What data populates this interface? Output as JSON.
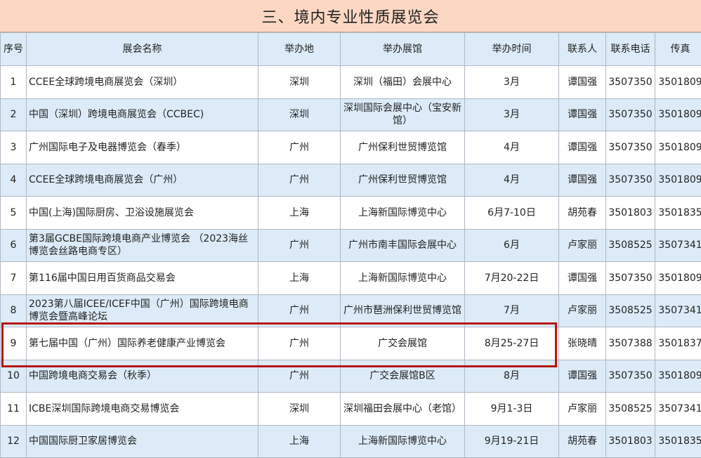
{
  "title": "三、境内专业性质展览会",
  "headers": [
    "序号",
    "展会名称",
    "举办地",
    "举办展馆",
    "举办时间",
    "联系人",
    "联系电话",
    "传真"
  ],
  "rows": [
    {
      "no": "1",
      "name": "CCEE全球跨境电商展览会（深圳）",
      "city": "深圳",
      "venue": "深圳（福田）会展中心",
      "time": "3月",
      "contact": "谭国强",
      "phone": "3507350",
      "fax": "3501809"
    },
    {
      "no": "2",
      "name": "中国（深圳）跨境电商展览会（CCBEC)",
      "city": "深圳",
      "venue": "深圳国际会展中心（宝安新馆）",
      "time": "3月",
      "contact": "谭国强",
      "phone": "3507350",
      "fax": "3501809"
    },
    {
      "no": "3",
      "name": "广州国际电子及电器博览会（春季）",
      "city": "广州",
      "venue": "广州保利世贸博览馆",
      "time": "4月",
      "contact": "谭国强",
      "phone": "3507350",
      "fax": "3501809"
    },
    {
      "no": "4",
      "name": "CCEE全球跨境电商展览会（广州）",
      "city": "广州",
      "venue": "广州保利世贸博览馆",
      "time": "4月",
      "contact": "谭国强",
      "phone": "3507350",
      "fax": "3501809"
    },
    {
      "no": "5",
      "name": "中国(上海)国际厨房、卫浴设施展览会",
      "city": "上海",
      "venue": "上海新国际博览中心",
      "time": "6月7-10日",
      "contact": "胡苑春",
      "phone": "3501803",
      "fax": "3501835"
    },
    {
      "no": "6",
      "name": "第3届GCBE国际跨境电商产业博览会 （2023海丝博览会丝路电商专区）",
      "city": "广州",
      "venue": "广州市南丰国际会展中心",
      "time": "6月",
      "contact": "卢家丽",
      "phone": "3508525",
      "fax": "3507341"
    },
    {
      "no": "7",
      "name": "第116届中国日用百货商品交易会",
      "city": "上海",
      "venue": "上海新国际博览中心",
      "time": "7月20-22日",
      "contact": "谭国强",
      "phone": "3507350",
      "fax": "3501809"
    },
    {
      "no": "8",
      "name": "2023第八届ICEE/ICEF中国（广州）国际跨境电商博览会暨高峰论坛",
      "city": "广州",
      "venue": "广州市琶洲保利世贸博览馆",
      "time": "7月",
      "contact": "卢家丽",
      "phone": "3508525",
      "fax": "3507341"
    },
    {
      "no": "9",
      "name": "第七届中国（广州）国际养老健康产业博览会",
      "city": "广州",
      "venue": "广交会展馆",
      "time": "8月25-27日",
      "contact": "张晓晴",
      "phone": "3507388",
      "fax": "3501837"
    },
    {
      "no": "10",
      "name": "中国跨境电商交易会（秋季）",
      "city": "广州",
      "venue": "广交会展馆B区",
      "time": "8月",
      "contact": "谭国强",
      "phone": "3507350",
      "fax": "3501809"
    },
    {
      "no": "11",
      "name": "ICBE深圳国际跨境电商交易博览会",
      "city": "深圳",
      "venue": "深圳福田会展中心（老馆）",
      "time": "9月1-3日",
      "contact": "卢家丽",
      "phone": "3508525",
      "fax": "3507341"
    },
    {
      "no": "12",
      "name": "中国国际厨卫家居博览会",
      "city": "上海",
      "venue": "上海新国际博览中心",
      "time": "9月19-21日",
      "contact": "胡苑春",
      "phone": "3501803",
      "fax": "3501835"
    }
  ],
  "highlight_color": "#b8140f",
  "header_bg": "#dcebf7",
  "title_bg": "#fcd8c4"
}
